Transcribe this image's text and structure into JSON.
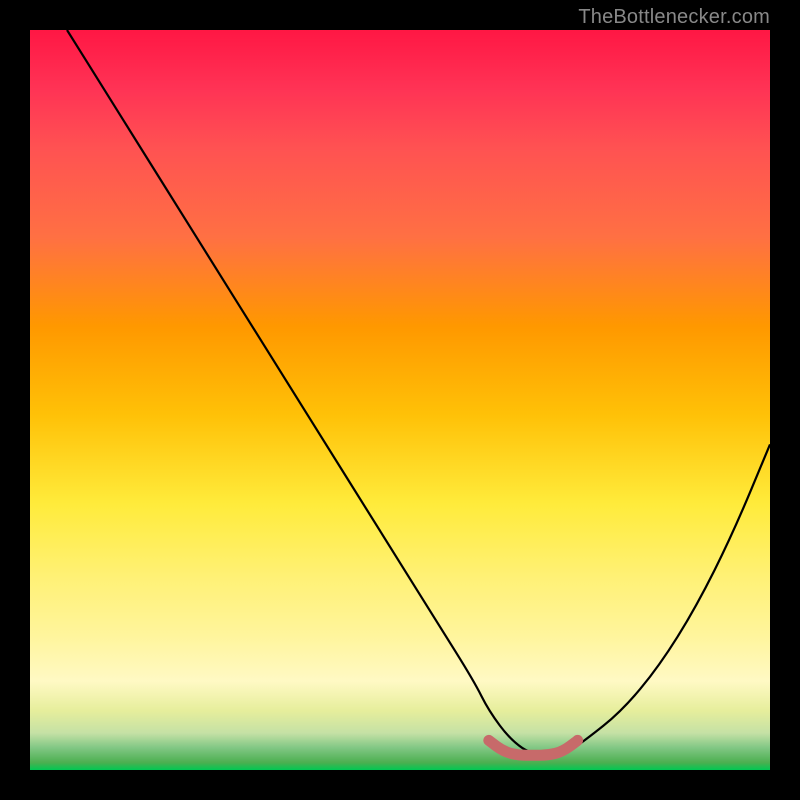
{
  "watermark": "TheBottlenecker.com",
  "chart_data": {
    "type": "line",
    "title": "",
    "xlabel": "",
    "ylabel": "",
    "xlim": [
      0,
      100
    ],
    "ylim": [
      0,
      100
    ],
    "series": [
      {
        "name": "bottleneck-curve",
        "x": [
          5,
          10,
          15,
          20,
          25,
          30,
          35,
          40,
          45,
          50,
          55,
          60,
          62,
          65,
          68,
          72,
          75,
          80,
          85,
          90,
          95,
          100
        ],
        "values": [
          100,
          92,
          84,
          76,
          68,
          60,
          52,
          44,
          36,
          28,
          20,
          12,
          8,
          4,
          2,
          2,
          4,
          8,
          14,
          22,
          32,
          44
        ]
      },
      {
        "name": "optimal-marker",
        "x": [
          62,
          64,
          66,
          68,
          70,
          72,
          74
        ],
        "values": [
          4,
          2.5,
          2,
          2,
          2,
          2.5,
          4
        ]
      }
    ],
    "background_gradient": {
      "top": "#ff1744",
      "mid": "#ffeb3b",
      "bottom": "#00c853"
    },
    "marker_color": "#c76a6a"
  }
}
